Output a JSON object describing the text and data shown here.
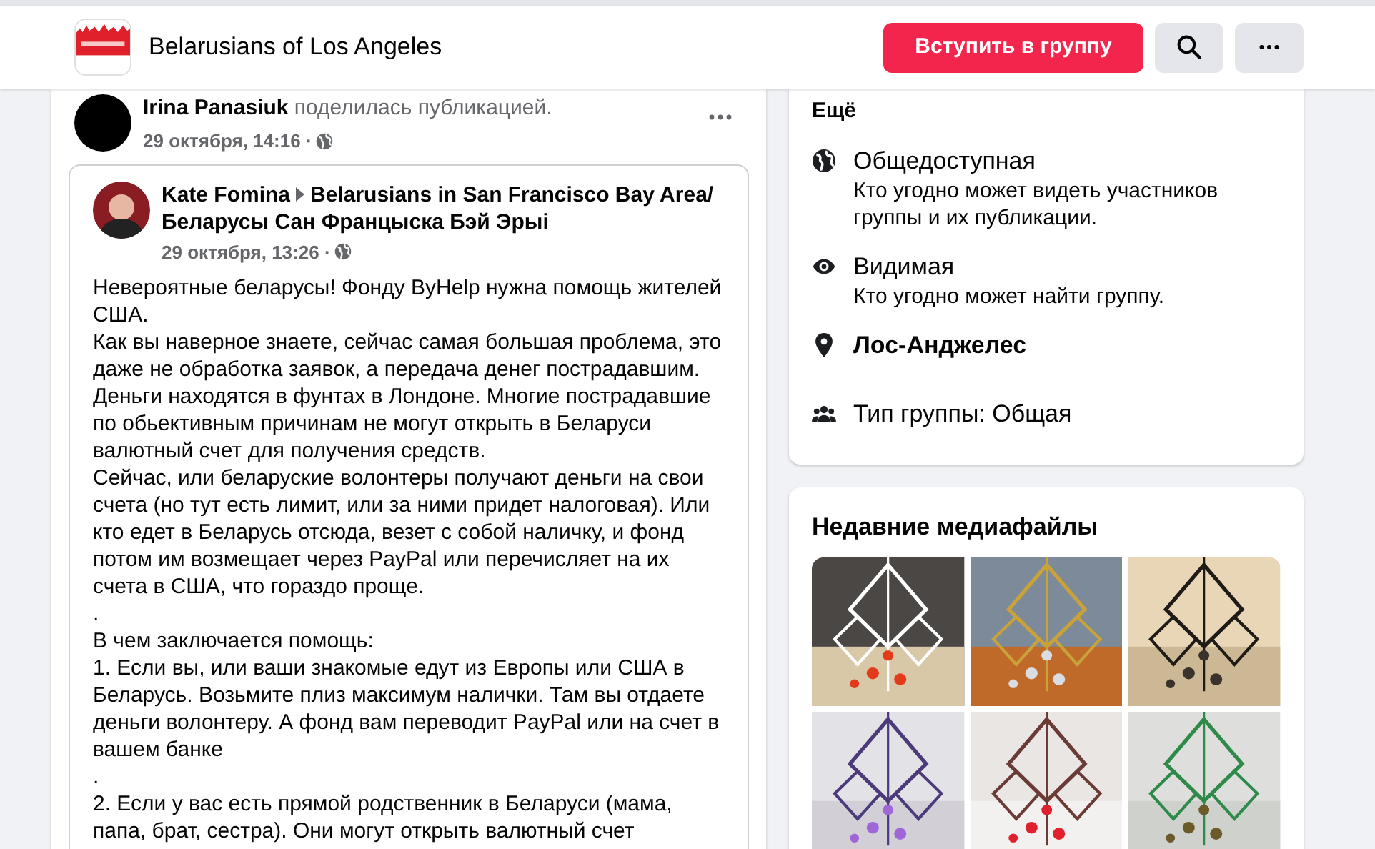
{
  "header": {
    "group_name": "Belarusians of Los Angeles",
    "join_button": "Вступить в группу"
  },
  "post": {
    "author": "Irina Panasiuk",
    "action": "поделилась публикацией.",
    "time": "29 октября, 14:16 ·",
    "shared": {
      "author": "Kate Fomina",
      "group_lines": [
        "Belarusians in San Francisco Bay Area/",
        "Беларусы Сан Францыска Бэй Эрыі"
      ],
      "time": "29 октября, 13:26 ·",
      "paragraphs": [
        "Невероятные беларусы! Фонду ByHelp нужна помощь жителей США.",
        "Как вы наверное знаете, сейчас самая большая проблема, это даже не обработка заявок, а передача денег пострадавшим. Деньги находятся в фунтах в Лондоне. Многие пострадавшие по обьективным причинам не могут открыть в Беларуси валютный счет для получения средств.",
        "Сейчас, или беларуские волонтеры получают деньги на свои счета (но тут есть лимит, или за ними придет налоговая). Или кто едет в Беларусь отсюда, везет с собой наличку, и фонд потом им возмещает через PayPal или перечисляет на их счета в США, что гораздо проще.",
        ".",
        "В чем заключается помощь:",
        "1. Если вы, или ваши знакомые едут из Европы или США в Беларусь. Возьмите плиз максимум налички. Там вы отдаете деньги волонтеру. А фонд вам переводит PayPal или на счет в вашем банке",
        ".",
        "2. Если у вас есть прямой родственник в Беларуси (мама, папа, брат, сестра). Они могут открыть валютный счет"
      ]
    }
  },
  "about": {
    "more_link": "Ещё",
    "items": [
      {
        "kind": "globe",
        "title": "Общедоступная",
        "description": "Кто угодно может видеть участников группы и их публикации."
      },
      {
        "kind": "eye",
        "title": "Видимая",
        "description": "Кто угодно может найти группу."
      },
      {
        "kind": "pin",
        "title": "Лос-Анджелес"
      },
      {
        "kind": "people",
        "title": "Тип группы: Общая"
      }
    ]
  },
  "media": {
    "title": "Недавние медиафайлы"
  }
}
